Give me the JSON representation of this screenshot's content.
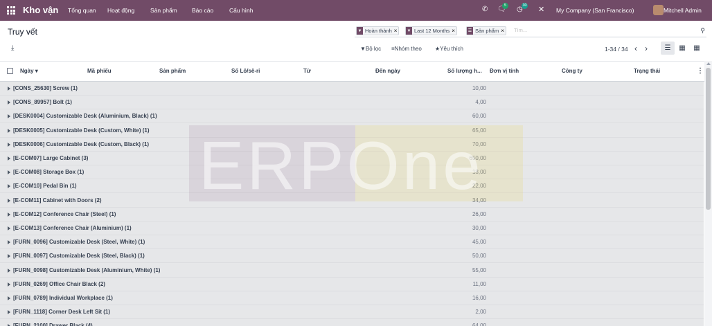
{
  "topbar": {
    "app_name": "Kho vận",
    "menu": [
      "Tổng quan",
      "Hoạt động",
      "Sản phẩm",
      "Báo cáo",
      "Cấu hình"
    ],
    "messages_badge": "5",
    "activities_badge": "30",
    "company": "My Company (San Francisco)",
    "user": "Mitchell Admin",
    "colors": {
      "bar": "#714b67",
      "badge_green": "#22a06b",
      "badge_teal": "#1a9e8f"
    }
  },
  "page": {
    "title": "Truy vết"
  },
  "search": {
    "facets": [
      {
        "icon": "filter-icon",
        "label": "Hoàn thành"
      },
      {
        "icon": "filter-icon",
        "label": "Last 12 Months"
      },
      {
        "icon": "group-by-icon",
        "label": "Sản phẩm"
      }
    ],
    "placeholder": "Tìm..."
  },
  "controls": {
    "filter": "Bộ lọc",
    "group_by": "Nhóm theo",
    "favorites": "Yêu thích"
  },
  "pager": {
    "text": "1-34 / 34"
  },
  "columns": [
    "Ngày",
    "Mã phiếu",
    "Sản phẩm",
    "Số Lô/sê-ri",
    "Từ",
    "Đến ngày",
    "Số lượng h...",
    "Đơn vị tính",
    "Công ty",
    "Trạng thái"
  ],
  "watermark": "ERPOne",
  "groups": [
    {
      "label": "[CONS_25630] Screw (1)",
      "qty": "10,00"
    },
    {
      "label": "[CONS_89957] Bolt (1)",
      "qty": "4,00"
    },
    {
      "label": "[DESK0004] Customizable Desk (Aluminium, Black) (1)",
      "qty": "60,00"
    },
    {
      "label": "[DESK0005] Customizable Desk (Custom, White) (1)",
      "qty": "65,00"
    },
    {
      "label": "[DESK0006] Customizable Desk (Custom, Black) (1)",
      "qty": "70,00"
    },
    {
      "label": "[E-COM07] Large Cabinet (3)",
      "qty": "650,00"
    },
    {
      "label": "[E-COM08] Storage Box (1)",
      "qty": "18,00"
    },
    {
      "label": "[E-COM10] Pedal Bin (1)",
      "qty": "22,00"
    },
    {
      "label": "[E-COM11] Cabinet with Doors (2)",
      "qty": "34,00"
    },
    {
      "label": "[E-COM12] Conference Chair (Steel) (1)",
      "qty": "26,00"
    },
    {
      "label": "[E-COM13] Conference Chair (Aluminium) (1)",
      "qty": "30,00"
    },
    {
      "label": "[FURN_0096] Customizable Desk (Steel, White) (1)",
      "qty": "45,00"
    },
    {
      "label": "[FURN_0097] Customizable Desk (Steel, Black) (1)",
      "qty": "50,00"
    },
    {
      "label": "[FURN_0098] Customizable Desk (Aluminium, White) (1)",
      "qty": "55,00"
    },
    {
      "label": "[FURN_0269] Office Chair Black (2)",
      "qty": "11,00"
    },
    {
      "label": "[FURN_0789] Individual Workplace (1)",
      "qty": "16,00"
    },
    {
      "label": "[FURN_1118] Corner Desk Left Sit (1)",
      "qty": "2,00"
    },
    {
      "label": "[FURN_2100] Drawer Black (4)",
      "qty": "64,00"
    }
  ]
}
